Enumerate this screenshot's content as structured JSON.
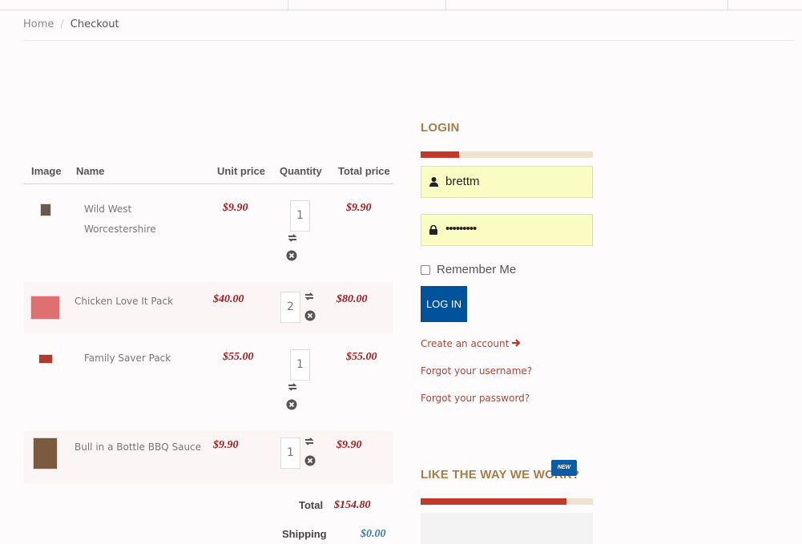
{
  "breadcrumb": {
    "home": "Home",
    "divider": "/",
    "current": "Checkout"
  },
  "cart": {
    "headers": {
      "image": "Image",
      "name": "Name",
      "unit_price": "Unit price",
      "quantity": "Quantity",
      "total_price": "Total price"
    },
    "items": [
      {
        "name_line1": "Wild West",
        "name_line2": "Worcestershire",
        "unit_price": "$9.90",
        "quantity": "1",
        "total": "$9.90"
      },
      {
        "name": "Chicken Love It Pack",
        "unit_price": "$40.00",
        "quantity": "2",
        "total": "$80.00"
      },
      {
        "name": "Family Saver Pack",
        "unit_price": "$55.00",
        "quantity": "1",
        "total": "$55.00"
      },
      {
        "name": "Bull in a Bottle BBQ Sauce",
        "unit_price": "$9.90",
        "quantity": "1",
        "total": "$9.90"
      }
    ],
    "total_label": "Total",
    "total_value": "$154.80",
    "shipping_label": "Shipping",
    "shipping_value": "$0.00",
    "colors": {
      "price": "#9a1b1b",
      "shipping": "#3a7ca5"
    }
  },
  "login": {
    "title": "LOGIN",
    "username_value": "brettm",
    "password_value": "•••••••••",
    "remember_label": "Remember Me",
    "button_label": "LOG IN",
    "create_account": "Create an account",
    "forgot_username": "Forgot your username?",
    "forgot_password": "Forgot your password?",
    "colors": {
      "field_bg": "#fafdc3",
      "button": "#00539b",
      "accent": "#c0392b"
    }
  },
  "promo": {
    "title": "LIKE THE WAY WE WORK?",
    "badge": "NEW"
  }
}
